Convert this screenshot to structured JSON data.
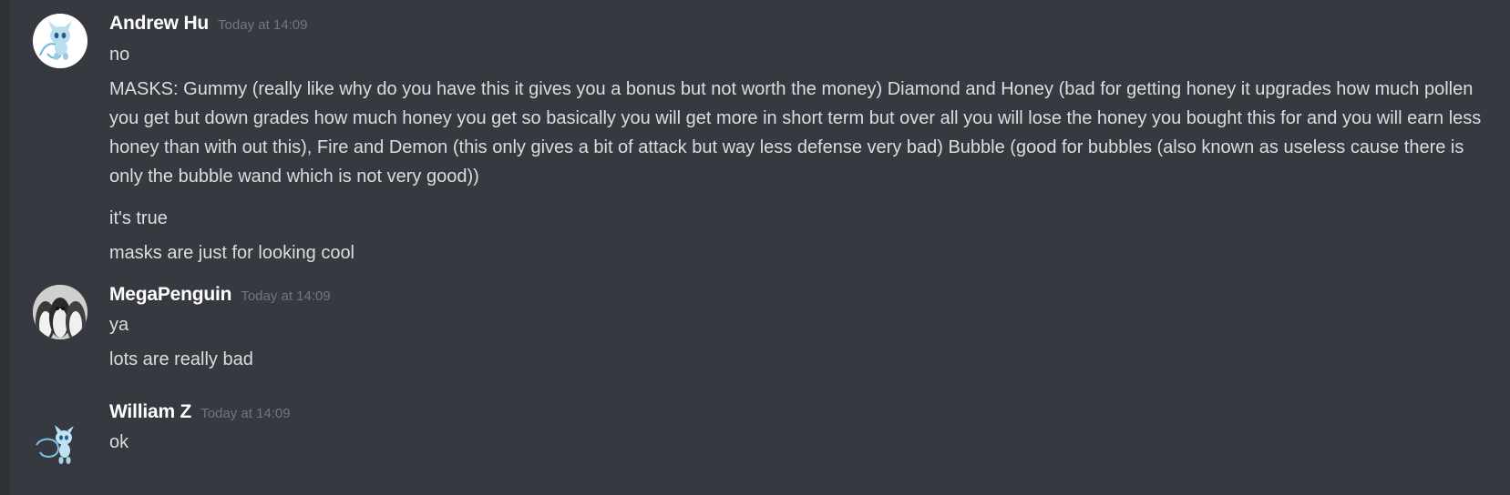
{
  "messages": [
    {
      "username": "Andrew Hu",
      "timestamp": "Today at 14:09",
      "avatar_icon": "mew-avatar-icon",
      "lines": [
        "no",
        "MASKS: Gummy (really like why do you have this it gives you a bonus but not worth the money) Diamond and Honey (bad for getting honey it upgrades how much pollen you get but down grades how much honey you get so basically you will get more in short term but over all you will lose the honey you bought this for and you will earn less honey than with out this), Fire and Demon (this only gives a bit of attack but  way less defense very bad) Bubble (good for bubbles (also known as useless cause there is only the bubble wand which is not very good))",
        "it's true",
        "masks are just for looking cool"
      ]
    },
    {
      "username": "MegaPenguin",
      "timestamp": "Today at 14:09",
      "avatar_icon": "penguins-avatar-icon",
      "lines": [
        "ya",
        "lots are really bad"
      ]
    },
    {
      "username": "William Z",
      "timestamp": "Today at 14:09",
      "avatar_icon": "mew-avatar-icon",
      "lines": [
        "ok"
      ]
    }
  ],
  "colors": {
    "background": "#36393f",
    "username": "#ffffff",
    "text": "#dcddde",
    "timestamp": "#72767d"
  }
}
